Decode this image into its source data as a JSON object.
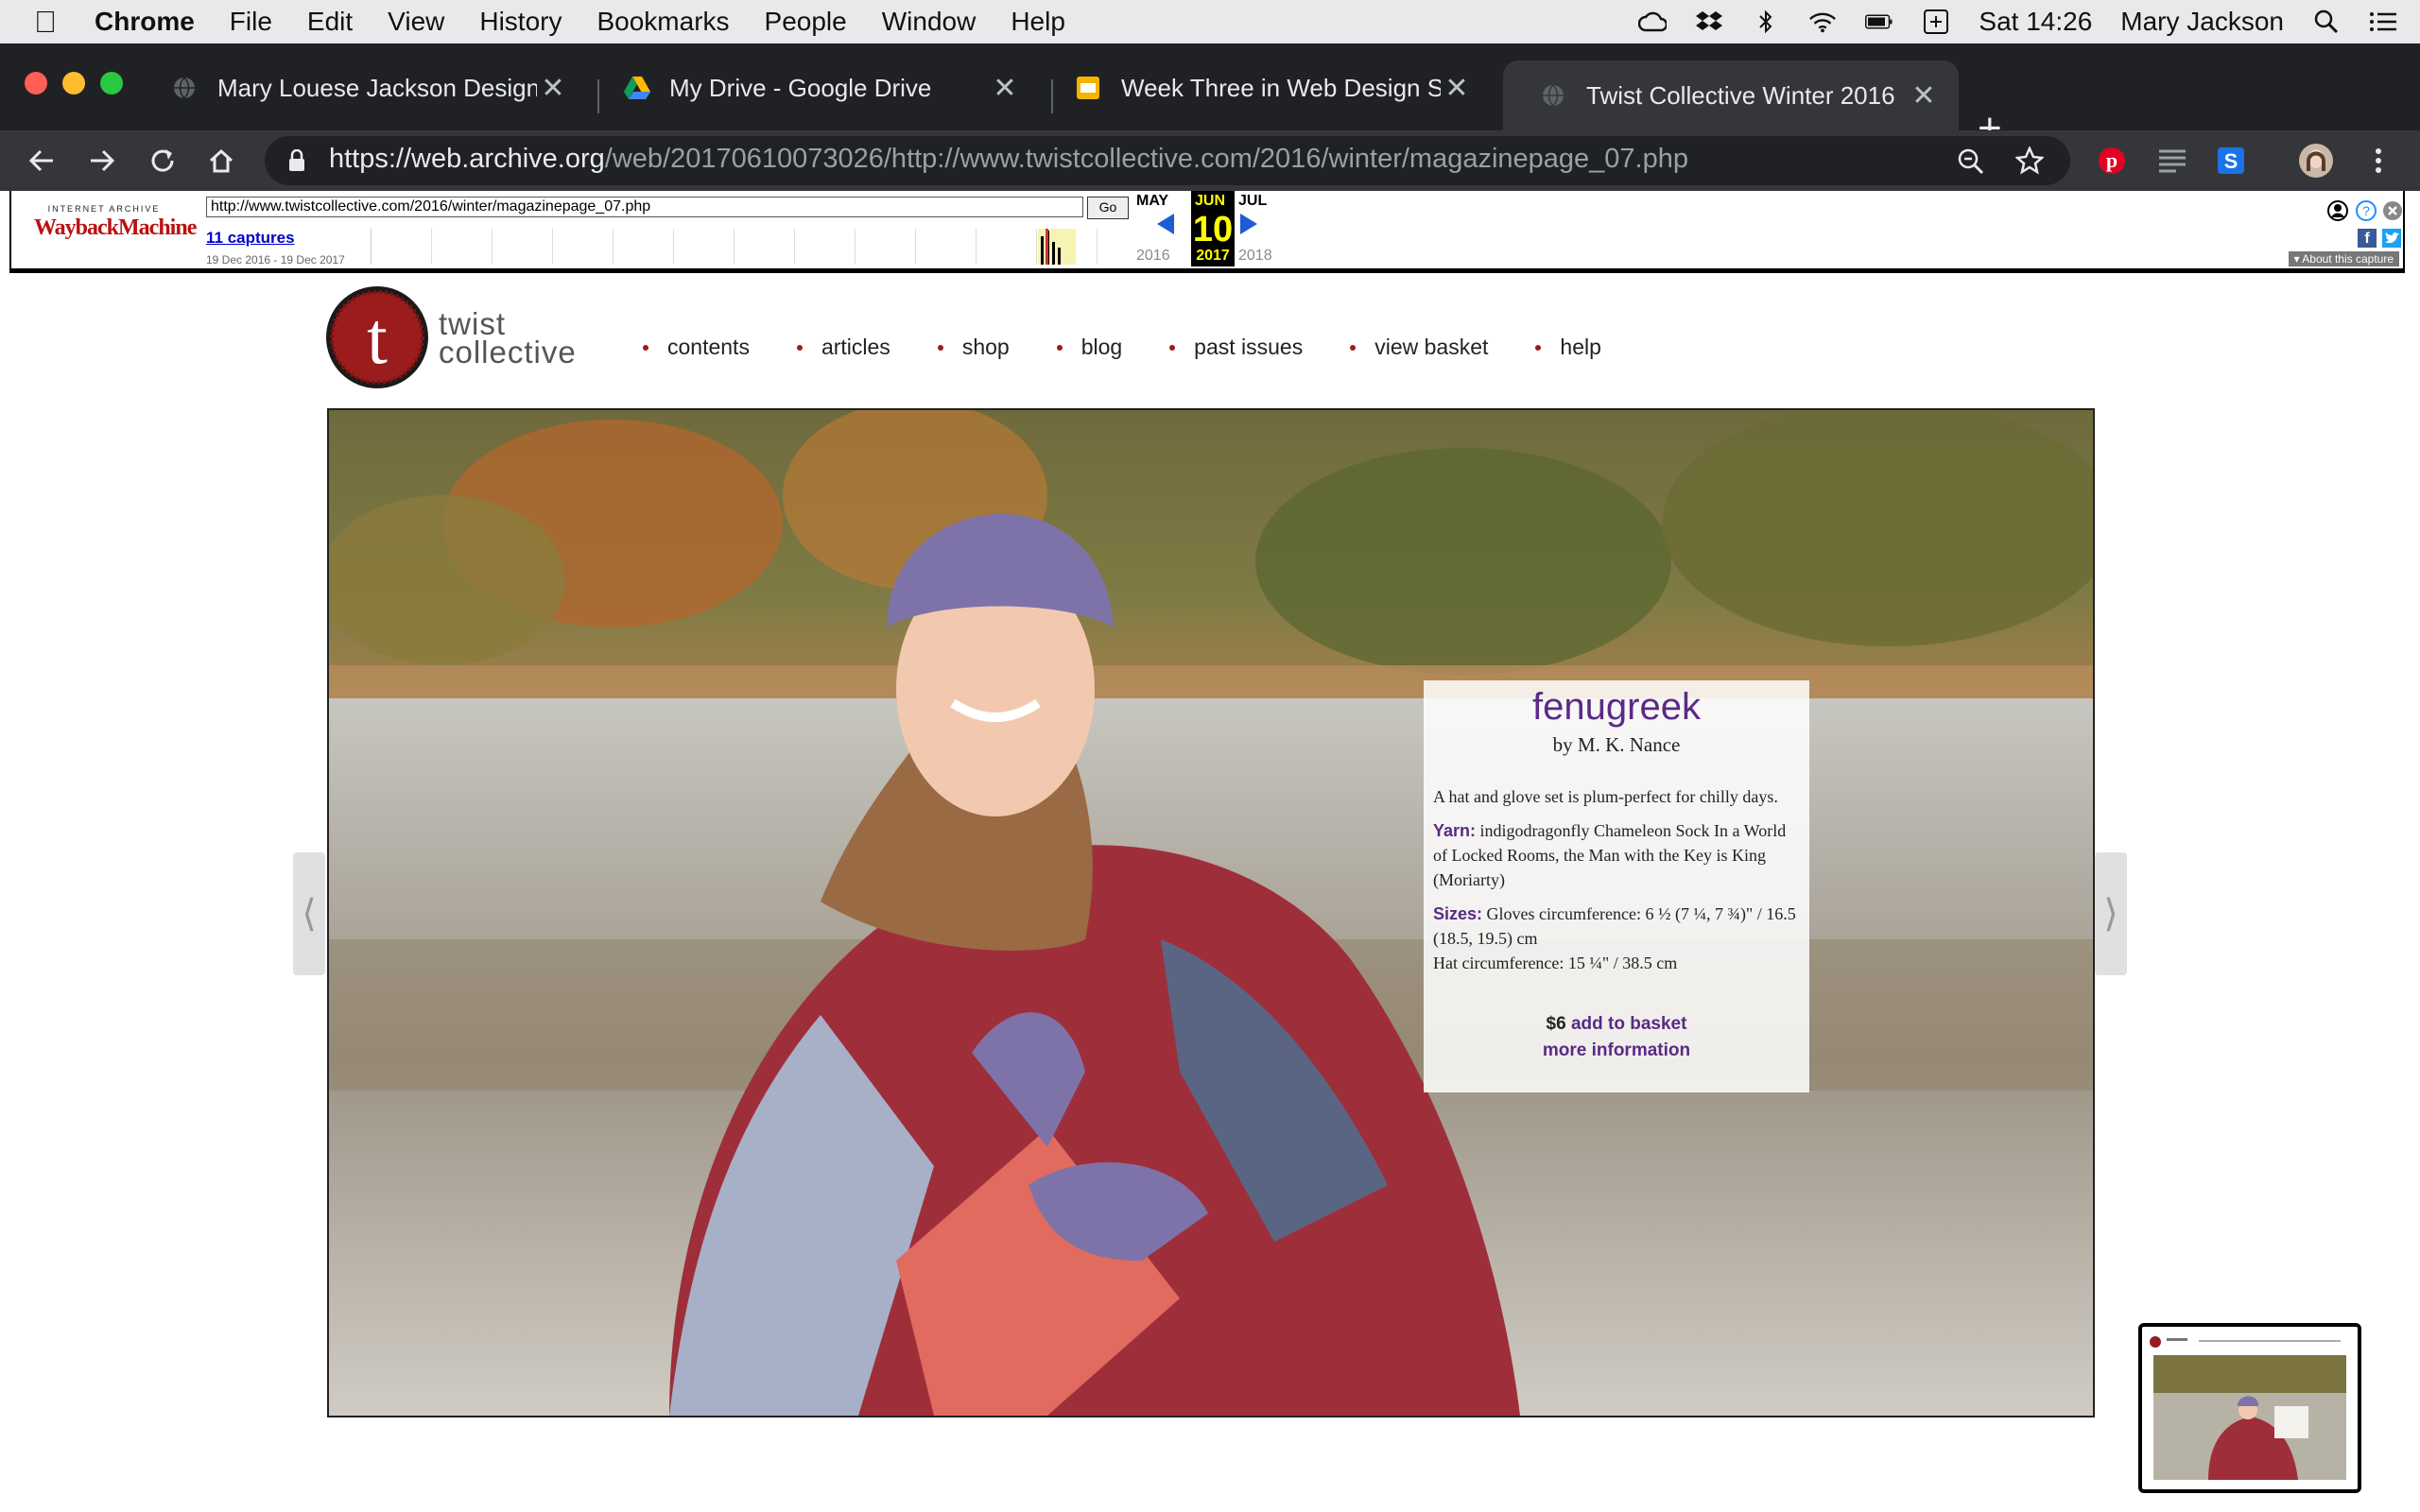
{
  "menubar": {
    "app": "Chrome",
    "items": [
      "File",
      "Edit",
      "View",
      "History",
      "Bookmarks",
      "People",
      "Window",
      "Help"
    ],
    "clock": "Sat 14:26",
    "user": "Mary Jackson"
  },
  "tabs": [
    {
      "title": "Mary Louese Jackson Designs"
    },
    {
      "title": "My Drive - Google Drive"
    },
    {
      "title": "Week Three in Web Design Stu"
    },
    {
      "title": "Twist Collective Winter 2016"
    }
  ],
  "toolbar": {
    "url_prefix": "https://",
    "url_domain": "web.archive.org",
    "url_rest": "/web/20170610073026/http://www.twistcollective.com/2016/winter/magazinepage_07.php"
  },
  "wayback": {
    "logo_top": "INTERNET ARCHIVE",
    "logo_main": "WaybackMachine",
    "url_value": "http://www.twistcollective.com/2016/winter/magazinepage_07.php",
    "go": "Go",
    "captures": "11 captures",
    "range": "19 Dec 2016 - 19 Dec 2017",
    "prev_month": "MAY",
    "cur_month": "JUN",
    "next_month": "JUL",
    "day": "10",
    "prev_year": "2016",
    "cur_year": "2017",
    "next_year": "2018",
    "about": "About this capture"
  },
  "site": {
    "logo_letter": "t",
    "brand_line1": "twist",
    "brand_line2": "collective",
    "nav": [
      "contents",
      "articles",
      "shop",
      "blog",
      "past issues",
      "view basket",
      "help"
    ]
  },
  "card": {
    "title": "fenugreek",
    "byline": "by M. K. Nance",
    "description": "A hat and glove set is plum-perfect for chilly days.",
    "yarn_label": "Yarn:",
    "yarn": "indigodragonfly Chameleon Sock In a World of Locked Rooms, the Man with the Key is King (Moriarty)",
    "sizes_label": "Sizes:",
    "sizes": "Gloves circumference: 6 ½ (7 ¼, 7 ¾)\" / 16.5 (18.5, 19.5) cm",
    "sizes2": "Hat circumference: 15 ¼\" / 38.5 cm",
    "price": "$6",
    "add": "add to basket",
    "more": "more information"
  },
  "colors": {
    "accent_purple": "#5b2a86",
    "logo_red": "#9b1c1c",
    "chrome_dark": "#202124"
  }
}
